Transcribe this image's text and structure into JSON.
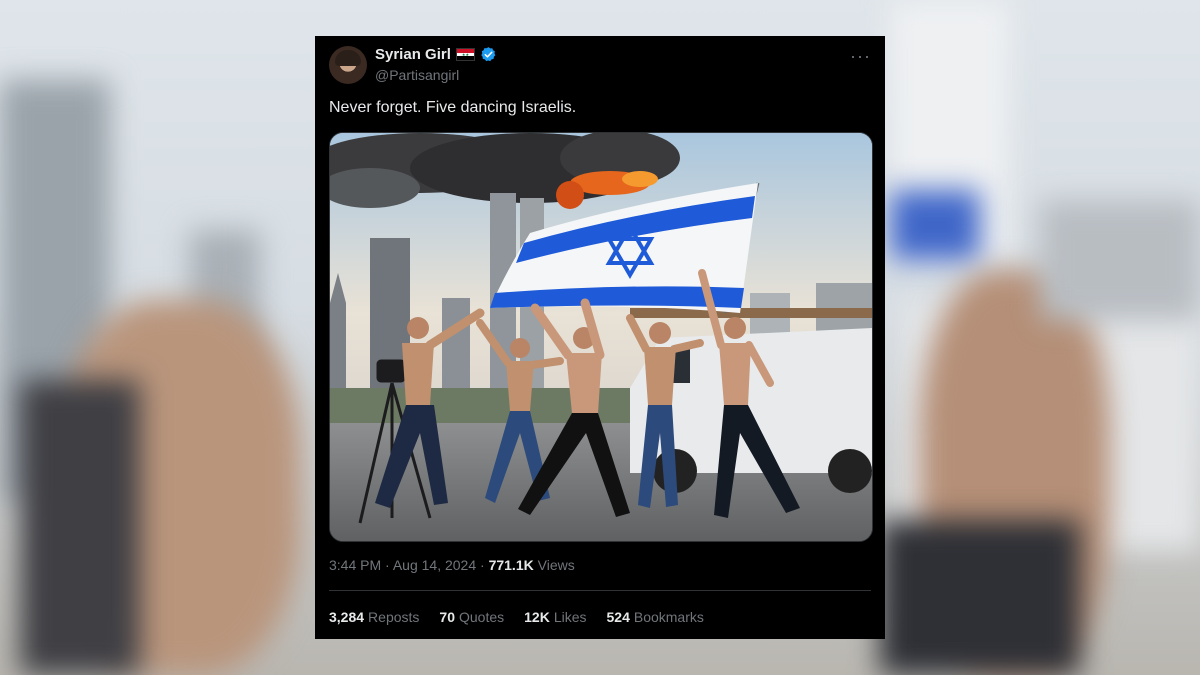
{
  "tweet": {
    "display_name": "Syrian Girl",
    "handle": "@Partisangirl",
    "text": "Never forget. Five dancing Israelis.",
    "time": "3:44 PM",
    "separator": "·",
    "date": "Aug 14, 2024",
    "views_count": "771.1K",
    "views_label": "Views",
    "more_glyph": "···",
    "stats": [
      {
        "count": "3,284",
        "label": "Reposts"
      },
      {
        "count": "70",
        "label": "Quotes"
      },
      {
        "count": "12K",
        "label": "Likes"
      },
      {
        "count": "524",
        "label": "Bookmarks"
      }
    ]
  },
  "icons": {
    "verified": "verified-badge-icon",
    "flag": "syria-flag-icon",
    "more": "more-options-icon"
  },
  "colors": {
    "card_bg": "#000000",
    "text_primary": "#e7e9ea",
    "text_secondary": "#71767b",
    "verified_blue": "#1d9bf0",
    "flag_blue": "#1f5bd8"
  }
}
